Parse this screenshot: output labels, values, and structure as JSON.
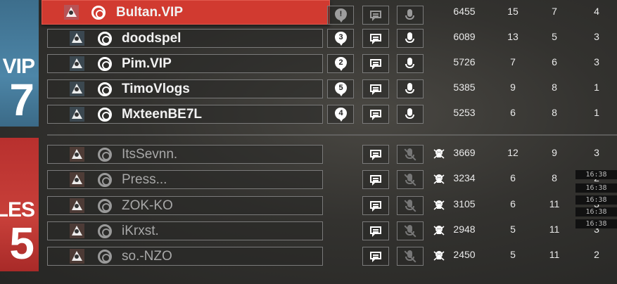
{
  "teams": {
    "blue": {
      "name": "VIP",
      "score": "7"
    },
    "orange": {
      "name": "LES",
      "score": "5"
    }
  },
  "players_blue": [
    {
      "name": "Bultan.VIP",
      "op": "op-icon",
      "pin": "",
      "score": "6455",
      "kills": "15",
      "assists": "7",
      "deaths": "4",
      "self": true,
      "muted": false
    },
    {
      "name": "doodspel",
      "op": "op-icon",
      "pin": "3",
      "score": "6089",
      "kills": "13",
      "assists": "5",
      "deaths": "3",
      "self": false,
      "muted": false
    },
    {
      "name": "Pim.VIP",
      "op": "op-icon",
      "pin": "2",
      "score": "5726",
      "kills": "7",
      "assists": "6",
      "deaths": "3",
      "self": false,
      "muted": false
    },
    {
      "name": "TimoVlogs",
      "op": "op-icon",
      "pin": "5",
      "score": "5385",
      "kills": "9",
      "assists": "8",
      "deaths": "1",
      "self": false,
      "muted": false
    },
    {
      "name": "MxteenBE7L",
      "op": "op-icon",
      "pin": "4",
      "score": "5253",
      "kills": "6",
      "assists": "8",
      "deaths": "1",
      "self": false,
      "muted": false
    }
  ],
  "players_orange": [
    {
      "name": "ItsSevnn.",
      "score": "3669",
      "kills": "12",
      "assists": "9",
      "deaths": "3"
    },
    {
      "name": "Press...",
      "score": "3234",
      "kills": "6",
      "assists": "8",
      "deaths": "2"
    },
    {
      "name": "ZOK-KO",
      "score": "3105",
      "kills": "6",
      "assists": "11",
      "deaths": "3"
    },
    {
      "name": "iKrxst.",
      "score": "2948",
      "kills": "5",
      "assists": "11",
      "deaths": "3"
    },
    {
      "name": "so.-NZO",
      "score": "2450",
      "kills": "5",
      "assists": "11",
      "deaths": "2"
    }
  ],
  "timestamps": [
    "16:38",
    "16:38",
    "16:38",
    "16:38",
    "16:38"
  ],
  "colors": {
    "self_row": "#d13a30",
    "team_blue": "#4d86a8",
    "team_orange": "#c8403a"
  }
}
